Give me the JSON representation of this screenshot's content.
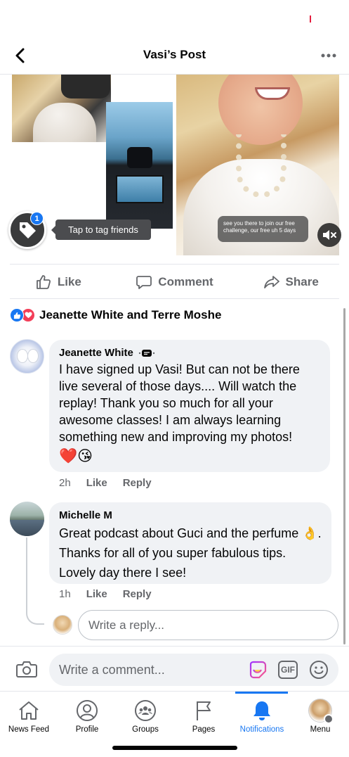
{
  "header": {
    "title": "Vasi’s Post"
  },
  "media": {
    "tag_badge_count": "1",
    "tag_tooltip": "Tap to tag friends",
    "video_caption": "see you there to join our free challenge, our free uh 5 days"
  },
  "actions": {
    "like": "Like",
    "comment": "Comment",
    "share": "Share"
  },
  "reactions": {
    "names": "Jeanette White and Terre Moshe"
  },
  "comments": [
    {
      "author": "Jeanette White",
      "text": "I have signed up Vasi! But can not be there live several of those days.... Will watch the replay! Thank you so much for all your awesome classes!  I am always learning something new and improving my photos!",
      "emoji": "❤️😘",
      "time": "2h",
      "like": "Like",
      "reply": "Reply"
    },
    {
      "author": "Michelle M",
      "text": "Great podcast about Guci and the perfume 👌.  Thanks for all of you super fabulous tips. Lovely day there I see!",
      "time": "1h",
      "like": "Like",
      "reply": "Reply"
    }
  ],
  "reply_input": {
    "placeholder": "Write a reply..."
  },
  "composer": {
    "placeholder": "Write a comment...",
    "gif": "GIF"
  },
  "tabs": [
    {
      "label": "News Feed",
      "icon": "home-icon"
    },
    {
      "label": "Profile",
      "icon": "profile-icon"
    },
    {
      "label": "Groups",
      "icon": "groups-icon"
    },
    {
      "label": "Pages",
      "icon": "flag-icon"
    },
    {
      "label": "Notifications",
      "icon": "bell-icon",
      "active": true
    },
    {
      "label": "Menu",
      "icon": "avatar"
    }
  ],
  "colors": {
    "accent": "#1877f2",
    "love": "#f33e58",
    "secondary_text": "#65676b",
    "bubble": "#f0f2f5"
  }
}
